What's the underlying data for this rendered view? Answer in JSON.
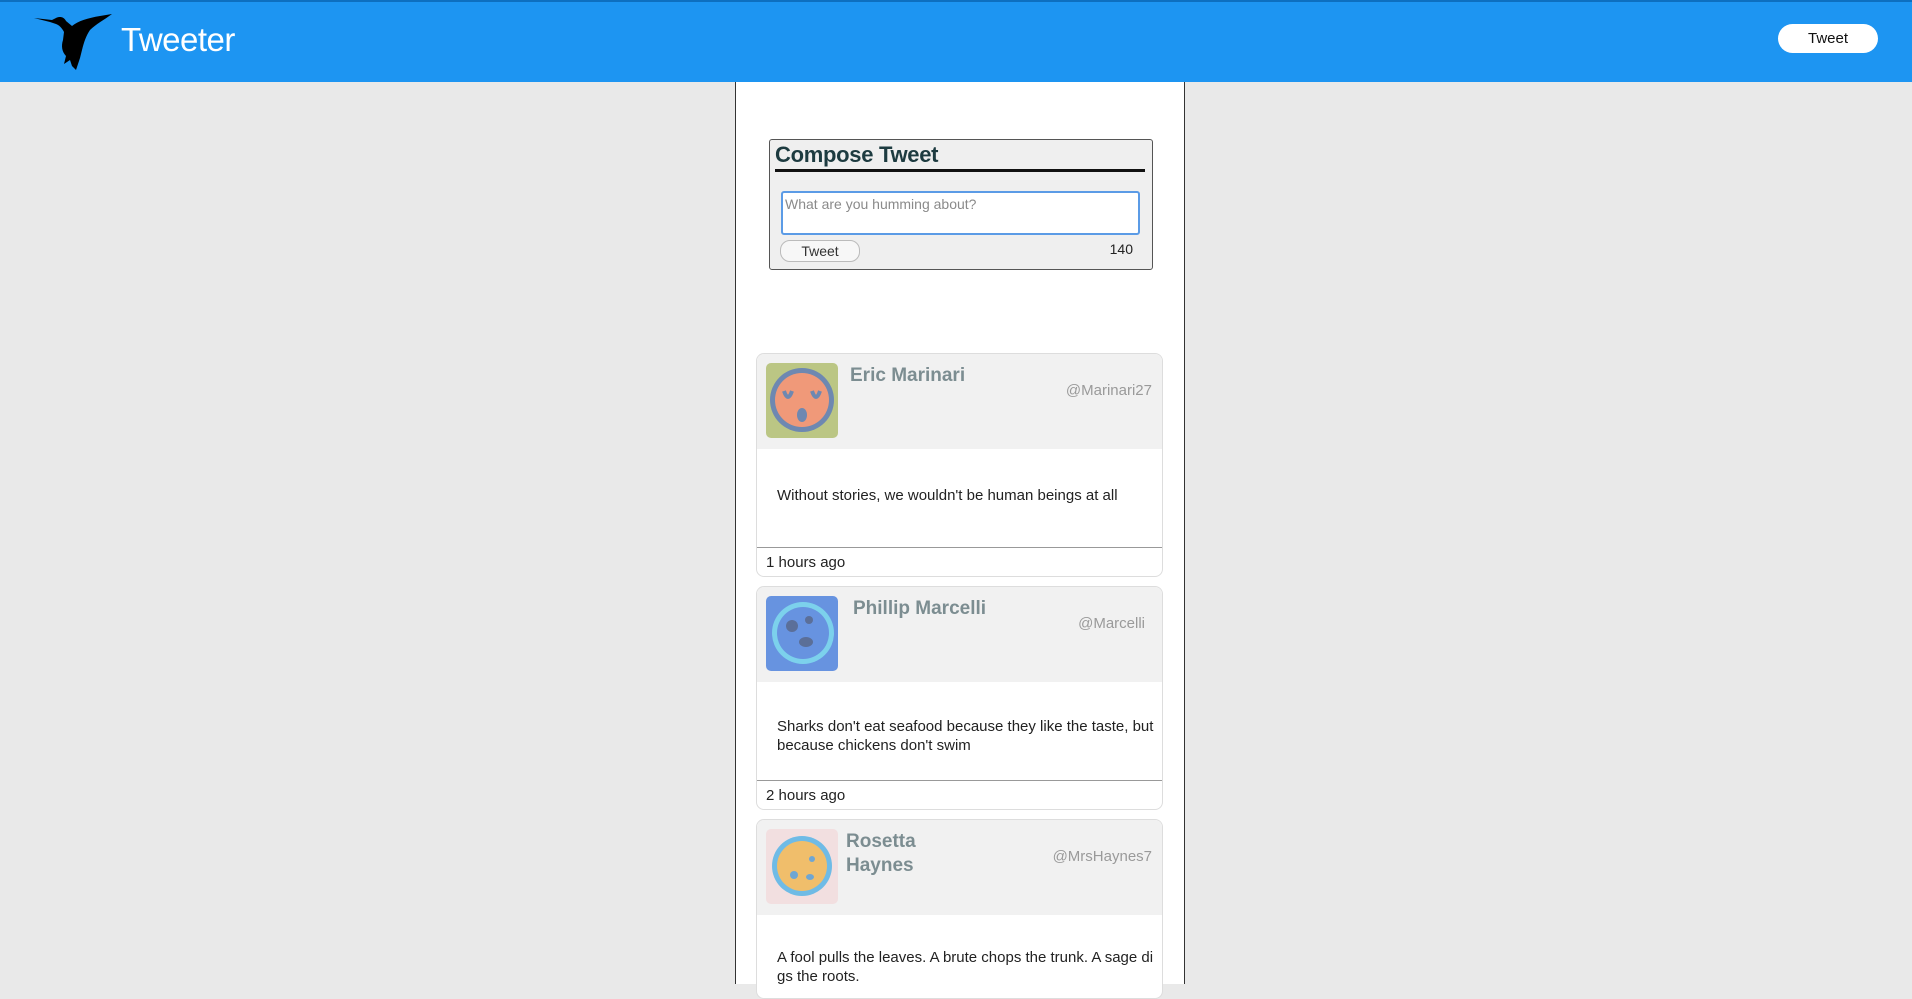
{
  "header": {
    "brand": "Tweeter",
    "tweet_button": "Tweet",
    "brand_color": "#1d95f2"
  },
  "compose": {
    "title": "Compose Tweet",
    "placeholder": "What are you humming about?",
    "button_label": "Tweet",
    "counter": "140"
  },
  "tweets": [
    {
      "name": "Eric Marinari",
      "handle": "@Marinari27",
      "text": "Without stories, we wouldn't be human beings at all",
      "time": "1 hours ago",
      "avatar_icon": "orange-face-avatar"
    },
    {
      "name": "Phillip Marcelli",
      "handle": "@Marcelli",
      "text": "Sharks don't eat seafood because they like the taste, but because chickens don't swim",
      "time": "2 hours ago",
      "avatar_icon": "blue-planet-avatar"
    },
    {
      "name": "Rosetta Haynes",
      "handle": "@MrsHaynes7",
      "text": "A fool pulls the leaves. A brute chops the trunk. A sage digs the roots.",
      "time": "",
      "avatar_icon": "orange-planet-avatar"
    }
  ]
}
